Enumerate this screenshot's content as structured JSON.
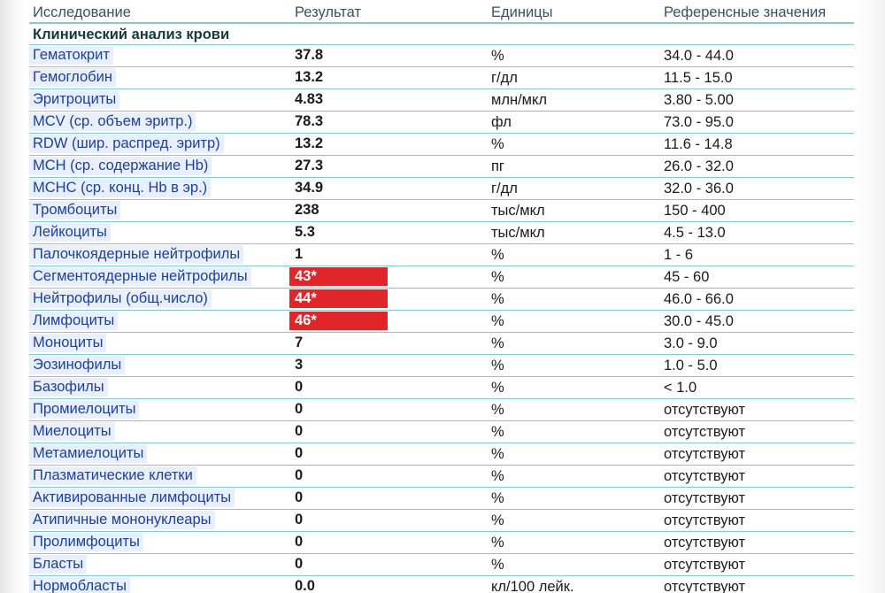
{
  "header": {
    "name": "Исследование",
    "result": "Результат",
    "units": "Единицы",
    "reference": "Референсные значения"
  },
  "section": {
    "title": "Клинический анализ крови"
  },
  "colors": {
    "flag": "#e0252b",
    "name_highlight": "#e8f0ff",
    "grid_line": "#86c9cc",
    "name_text": "#1e3f9c"
  },
  "rows": [
    {
      "name": "Гематокрит",
      "result": "37.8",
      "units": "%",
      "reference": "34.0 - 44.0",
      "flagged": false
    },
    {
      "name": "Гемоглобин",
      "result": "13.2",
      "units": "г/дл",
      "reference": "11.5 - 15.0",
      "flagged": false
    },
    {
      "name": "Эритроциты",
      "result": "4.83",
      "units": "млн/мкл",
      "reference": "3.80 - 5.00",
      "flagged": false
    },
    {
      "name": "MCV (ср. объем эритр.)",
      "result": "78.3",
      "units": "фл",
      "reference": "73.0 - 95.0",
      "flagged": false
    },
    {
      "name": "RDW (шир. распред. эритр)",
      "result": "13.2",
      "units": "%",
      "reference": "11.6 - 14.8",
      "flagged": false
    },
    {
      "name": "MCH (ср. содержание Hb)",
      "result": "27.3",
      "units": "пг",
      "reference": "26.0 - 32.0",
      "flagged": false
    },
    {
      "name": "MCHC (ср. конц. Hb в эр.)",
      "result": "34.9",
      "units": "г/дл",
      "reference": "32.0 - 36.0",
      "flagged": false
    },
    {
      "name": "Тромбоциты",
      "result": "238",
      "units": "тыс/мкл",
      "reference": "150 - 400",
      "flagged": false
    },
    {
      "name": "Лейкоциты",
      "result": "5.3",
      "units": "тыс/мкл",
      "reference": "4.5 - 13.0",
      "flagged": false
    },
    {
      "name": "Палочкоядерные нейтрофилы",
      "result": "1",
      "units": "%",
      "reference": "1 - 6",
      "flagged": false
    },
    {
      "name": "Сегментоядерные нейтрофилы",
      "result": "43*",
      "units": "%",
      "reference": "45 - 60",
      "flagged": true
    },
    {
      "name": "Нейтрофилы (общ.число)",
      "result": "44*",
      "units": "%",
      "reference": "46.0 - 66.0",
      "flagged": true
    },
    {
      "name": "Лимфоциты",
      "result": "46*",
      "units": "%",
      "reference": "30.0 - 45.0",
      "flagged": true
    },
    {
      "name": "Моноциты",
      "result": "7",
      "units": "%",
      "reference": "3.0 - 9.0",
      "flagged": false
    },
    {
      "name": "Эозинофилы",
      "result": "3",
      "units": "%",
      "reference": "1.0 - 5.0",
      "flagged": false
    },
    {
      "name": "Базофилы",
      "result": "0",
      "units": "%",
      "reference": "< 1.0",
      "flagged": false
    },
    {
      "name": "Промиелоциты",
      "result": "0",
      "units": "%",
      "reference": "отсутствуют",
      "flagged": false
    },
    {
      "name": "Миелоциты",
      "result": "0",
      "units": "%",
      "reference": "отсутствуют",
      "flagged": false
    },
    {
      "name": "Метамиелоциты",
      "result": "0",
      "units": "%",
      "reference": "отсутствуют",
      "flagged": false
    },
    {
      "name": "Плазматические клетки",
      "result": "0",
      "units": "%",
      "reference": "отсутствуют",
      "flagged": false
    },
    {
      "name": "Активированные лимфоциты",
      "result": "0",
      "units": "%",
      "reference": "отсутствуют",
      "flagged": false
    },
    {
      "name": "Атипичные мононуклеары",
      "result": "0",
      "units": "%",
      "reference": "отсутствуют",
      "flagged": false
    },
    {
      "name": "Пролимфоциты",
      "result": "0",
      "units": "%",
      "reference": "отсутствуют",
      "flagged": false
    },
    {
      "name": "Бласты",
      "result": "0",
      "units": "%",
      "reference": "отсутствуют",
      "flagged": false
    },
    {
      "name": "Нормобласты",
      "result": "0.0",
      "units": "кл/100 лейк.",
      "reference": "отсутствуют",
      "flagged": false
    }
  ]
}
